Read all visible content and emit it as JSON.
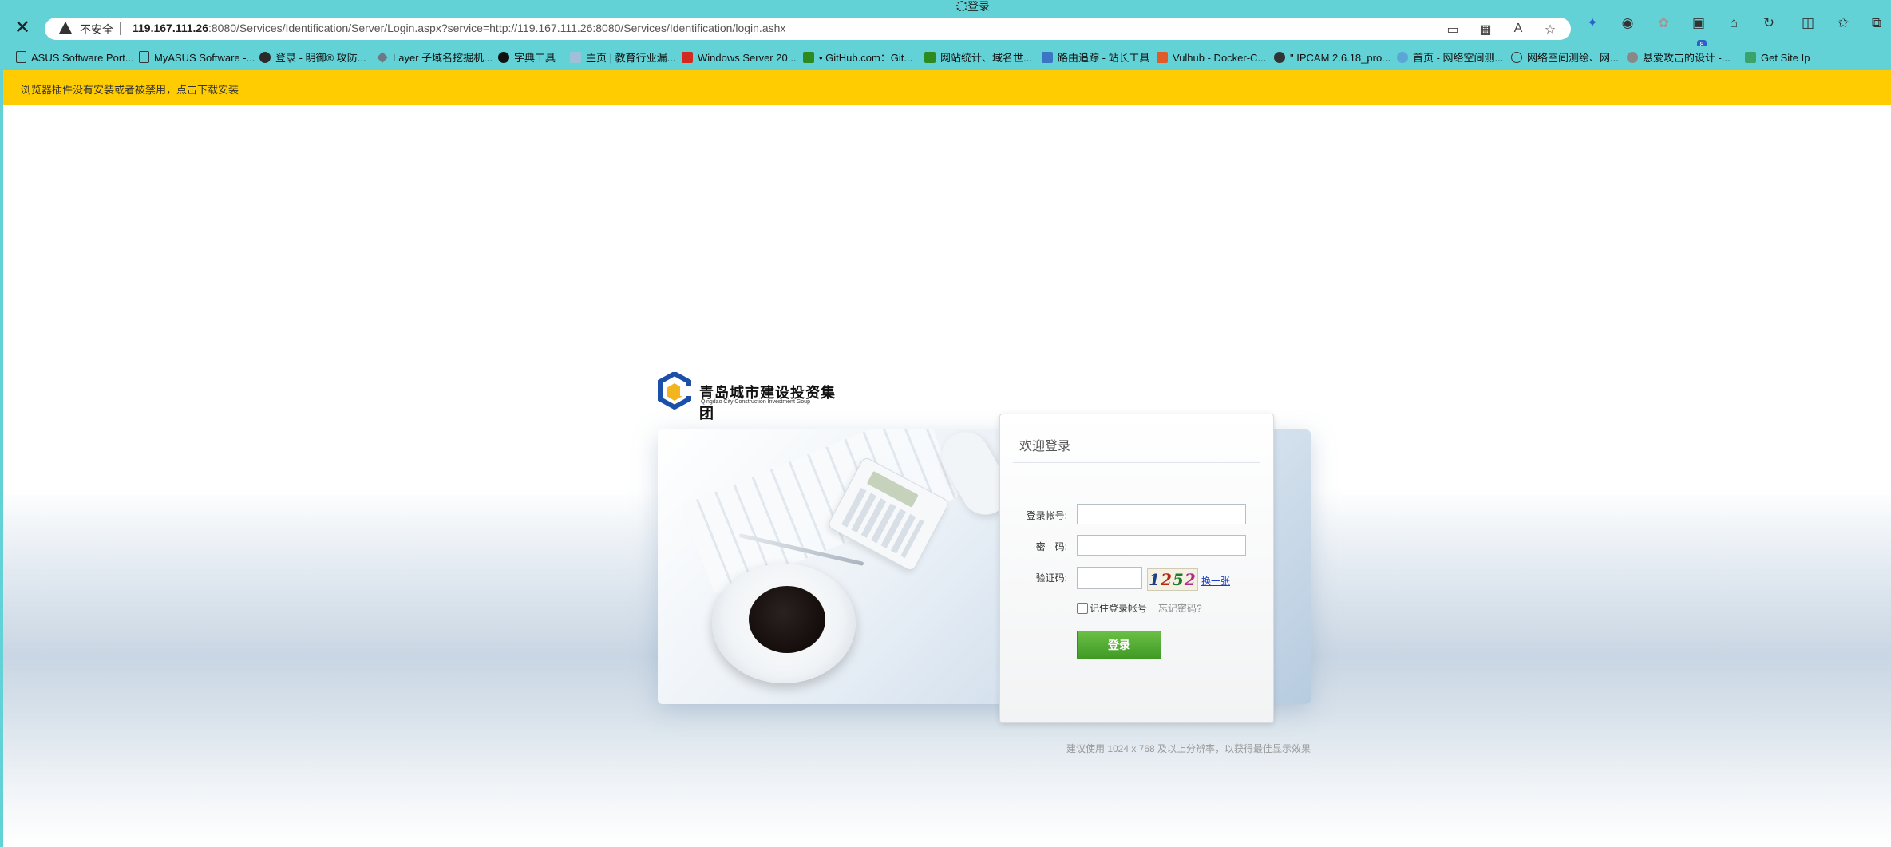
{
  "browser": {
    "tab_title": "登录",
    "security_label": "不安全",
    "url_host": "119.167.111.26",
    "url_rest": ":8080/Services/Identification/Server/Login.aspx?service=http://119.167.111.26:8080/Services/Identification/login.ashx",
    "extension_badge": "8",
    "bookmarks": [
      {
        "label": "ASUS Software Port...",
        "icon": "page-icon"
      },
      {
        "label": "MyASUS Software -...",
        "icon": "page-icon"
      },
      {
        "label": "登录 - 明御® 攻防...",
        "icon": "user-icon"
      },
      {
        "label": "Layer 子域名挖掘机...",
        "icon": "layer-icon"
      },
      {
        "label": "字典工具",
        "icon": "github-icon"
      },
      {
        "label": "主页 | 教育行业漏...",
        "icon": "edu-icon"
      },
      {
        "label": "Windows Server 20...",
        "icon": "51-icon"
      },
      {
        "label": "• GitHub.com：Git...",
        "icon": "arrow-icon"
      },
      {
        "label": "网站统计、域名世...",
        "icon": "arrow-icon"
      },
      {
        "label": "路由追踪 - 站长工具",
        "icon": "tools-icon"
      },
      {
        "label": "Vulhub - Docker-C...",
        "icon": "vulhub-icon"
      },
      {
        "label": "\" IPCAM 2.6.18_pro...",
        "icon": "cam-icon"
      },
      {
        "label": "首页 - 网络空间测...",
        "icon": "eye-icon"
      },
      {
        "label": "网络空间测绘、网...",
        "icon": "f-icon"
      },
      {
        "label": "悬爱攻击的设计 -...",
        "icon": "gear-icon"
      },
      {
        "label": "Get Site Ip",
        "icon": "ip-icon"
      }
    ]
  },
  "infobar": {
    "message": "浏览器插件没有安装或者被禁用，点击下载安装"
  },
  "logo": {
    "name_cn": "青岛城市建设投资集团",
    "name_en": "Qingdao City Construction Investment Goup"
  },
  "login": {
    "heading": "欢迎登录",
    "account_label": "登录帐号:",
    "account_value": "",
    "password_label": "密　码:",
    "password_value": "",
    "captcha_label": "验证码:",
    "captcha_value": "",
    "captcha_digits": [
      "1",
      "2",
      "5",
      "2"
    ],
    "refresh_label": "换一张",
    "remember_label": "记住登录帐号",
    "forgot_label": "忘记密码?",
    "submit_label": "登录"
  },
  "footer": {
    "tip": "建议使用 1024 x 768 及以上分辨率，以获得最佳显示效果"
  },
  "colors": {
    "chrome": "#63d2d6",
    "infobar": "#fecc00",
    "button": "#4fa92f",
    "link": "#1a3fc9"
  }
}
